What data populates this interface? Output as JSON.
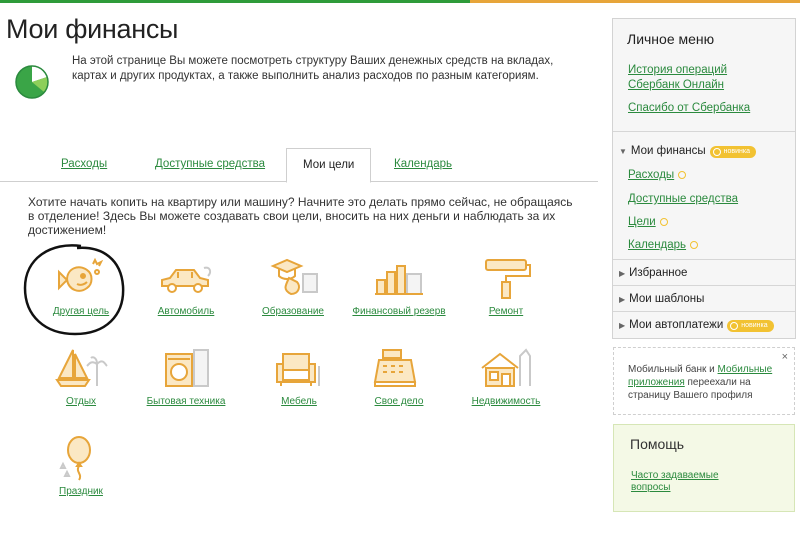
{
  "page": {
    "title": "Мои финансы",
    "intro": "На этой странице Вы можете посмотреть структуру Ваших денежных средств на вкладах, картах и других продуктах, а также выполнить анализ расходов по разным категориям."
  },
  "tabs": [
    {
      "label": "Расходы",
      "active": false
    },
    {
      "label": "Доступные средства",
      "active": false
    },
    {
      "label": "Мои цели",
      "active": true
    },
    {
      "label": "Календарь",
      "active": false
    }
  ],
  "goals_intro": "Хотите начать копить на квартиру или машину? Начните это делать прямо сейчас, не обращаясь в отделение! Здесь Вы можете создавать свои цели, вносить на них деньги и наблюдать за их достижением!",
  "goals": [
    {
      "label": "Другая цель",
      "icon": "goldfish-icon"
    },
    {
      "label": "Автомобиль",
      "icon": "car-icon"
    },
    {
      "label": "Образование",
      "icon": "graduation-icon"
    },
    {
      "label": "Финансовый резерв",
      "icon": "reserve-icon"
    },
    {
      "label": "Ремонт",
      "icon": "paint-roller-icon"
    },
    {
      "label": "Отдых",
      "icon": "sailboat-icon"
    },
    {
      "label": "Бытовая техника",
      "icon": "appliance-icon"
    },
    {
      "label": "Мебель",
      "icon": "armchair-icon"
    },
    {
      "label": "Свое дело",
      "icon": "cash-register-icon"
    },
    {
      "label": "Недвижимость",
      "icon": "house-icon"
    },
    {
      "label": "Праздник",
      "icon": "balloon-icon"
    }
  ],
  "sidebar": {
    "title": "Личное меню",
    "links": [
      "История операций Сбербанк Онлайн",
      "Спасибо от Сбербанка"
    ],
    "finances": {
      "label": "Мои финансы",
      "badge": "новинка",
      "items": [
        "Расходы",
        "Доступные средства",
        "Цели",
        "Календарь"
      ]
    },
    "favorites": "Избранное",
    "templates": "Мои шаблоны",
    "autopay": {
      "label": "Мои автоплатежи",
      "badge": "новинка"
    }
  },
  "notice": {
    "text_before": "Мобильный банк и ",
    "link": "Мобильные приложения",
    "text_after": " переехали на страницу Вашего профиля",
    "close": "×"
  },
  "help": {
    "title": "Помощь",
    "faq": "Часто задаваемые вопросы"
  },
  "colors": {
    "accent": "#2e9b3a",
    "link": "#2b8a3e",
    "icon": "#e7a53a",
    "badge": "#f2c232"
  }
}
